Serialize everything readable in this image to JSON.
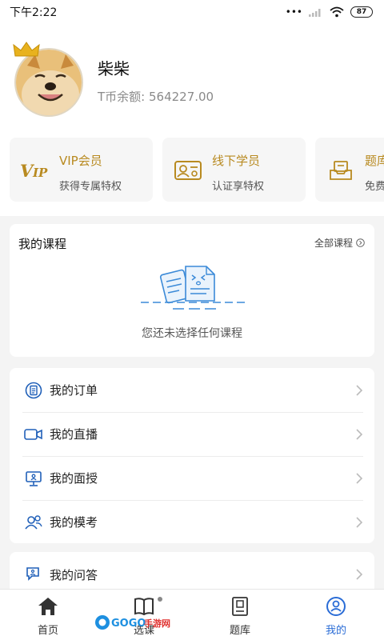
{
  "status": {
    "time": "下午2:22",
    "battery": "87"
  },
  "profile": {
    "username": "柴柴",
    "balance": "T币余额:  564227.00"
  },
  "cards": [
    {
      "icon": "vip-icon",
      "title": "VIP会员",
      "subtitle": "获得专属特权"
    },
    {
      "icon": "id-card-icon",
      "title": "线下学员",
      "subtitle": "认证享特权"
    },
    {
      "icon": "question-bank-icon",
      "title": "题库",
      "subtitle": "免费"
    }
  ],
  "courses": {
    "title": "我的课程",
    "all_label": "全部课程",
    "empty_text": "您还未选择任何课程"
  },
  "menu": {
    "items": [
      {
        "icon": "order-icon",
        "label": "我的订单"
      },
      {
        "icon": "live-camera-icon",
        "label": "我的直播"
      },
      {
        "icon": "lecture-icon",
        "label": "我的面授"
      },
      {
        "icon": "mock-exam-icon",
        "label": "我的模考"
      }
    ],
    "qa": {
      "icon": "qa-icon",
      "label": "我的问答"
    }
  },
  "tabbar": {
    "items": [
      {
        "icon": "home-icon",
        "label": "首页"
      },
      {
        "icon": "book-icon",
        "label": "选课"
      },
      {
        "icon": "question-bank-tab-icon",
        "label": "题库"
      },
      {
        "icon": "profile-icon",
        "label": "我的"
      }
    ]
  },
  "watermark": {
    "text": "GOGO手游网"
  },
  "colors": {
    "gold": "#b88a20",
    "blue": "#2a6cd6",
    "icon_blue": "#1f5fb8"
  }
}
